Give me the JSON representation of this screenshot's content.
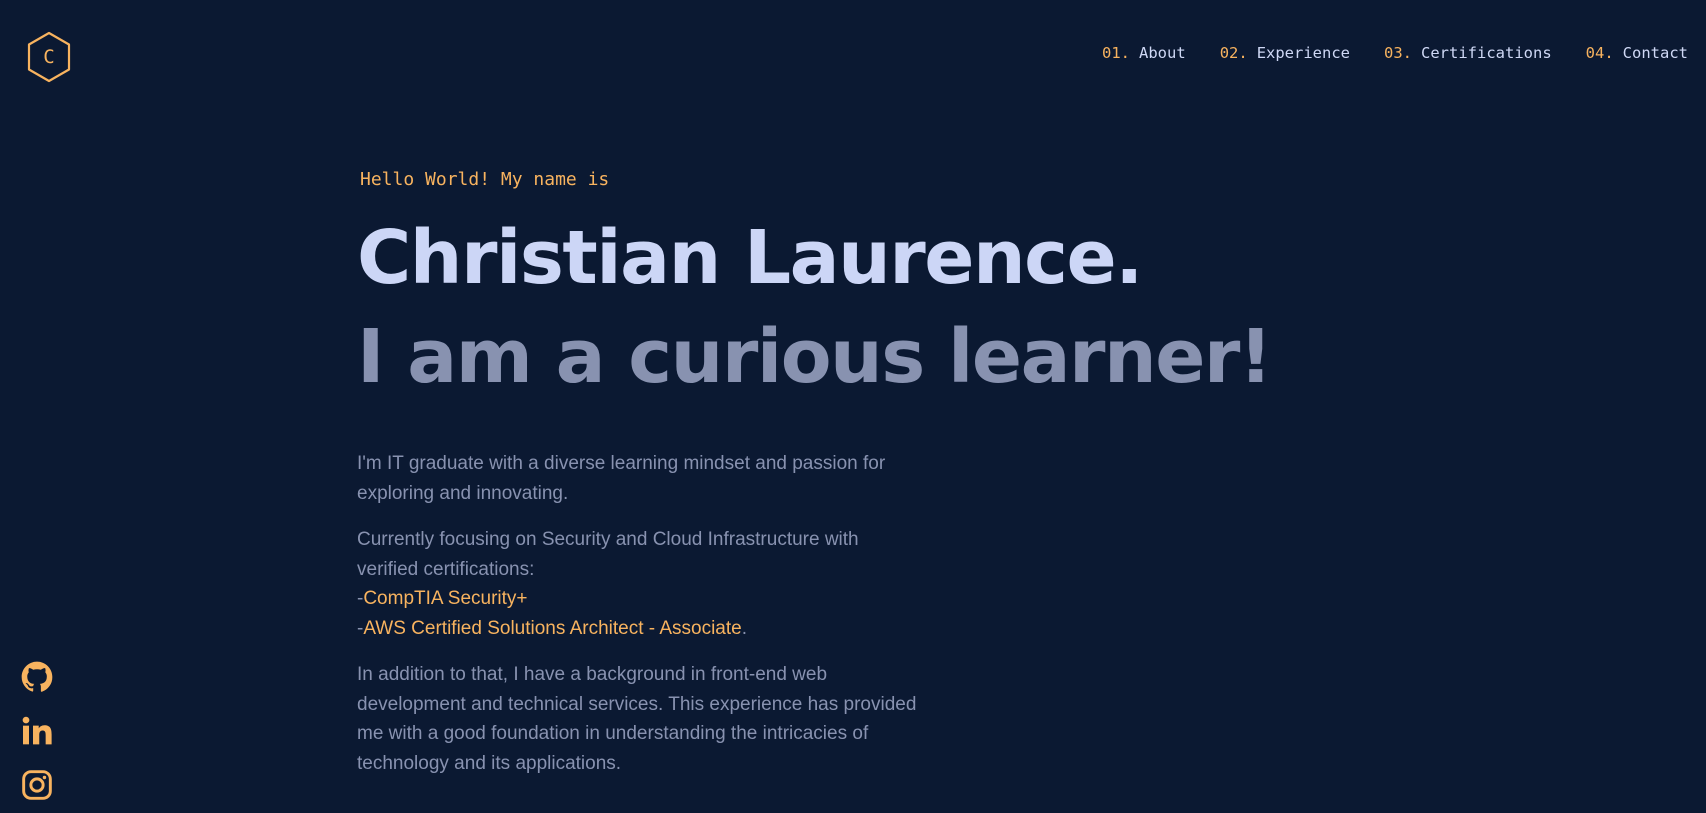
{
  "logo": {
    "letter": "C",
    "icon": "hexagon-logo-icon"
  },
  "nav": [
    {
      "num": "01.",
      "label": "About"
    },
    {
      "num": "02.",
      "label": "Experience"
    },
    {
      "num": "03.",
      "label": "Certifications"
    },
    {
      "num": "04.",
      "label": "Contact"
    }
  ],
  "hero": {
    "greeting": "Hello World! My name is",
    "name": "Christian Laurence.",
    "tagline": "I am a curious learner!"
  },
  "bio": {
    "p1": "I'm IT graduate with a diverse learning mindset and passion for exploring and innovating.",
    "p2_intro": "Currently focusing on Security and Cloud Infrastructure with verified certifications:",
    "cert1_prefix": "-",
    "cert1": "CompTIA Security+",
    "cert2_prefix": "-",
    "cert2": "AWS Certified Solutions Architect - Associate",
    "cert2_suffix": ".",
    "p3": "In addition to that, I have a background in front-end web development and technical services. This experience has provided me with a good foundation in understanding the intricacies of technology and its applications."
  },
  "socials": [
    {
      "icon": "github-icon"
    },
    {
      "icon": "linkedin-icon"
    },
    {
      "icon": "instagram-icon"
    }
  ],
  "colors": {
    "background": "#0b1932",
    "accent": "#f8b35f",
    "heading": "#ccd6f6",
    "body_text": "#8892b0"
  }
}
